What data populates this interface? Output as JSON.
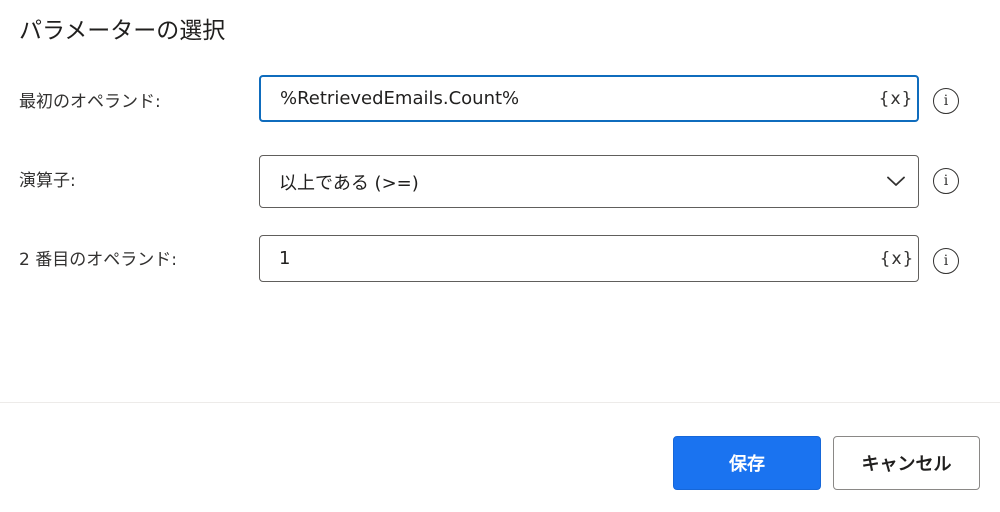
{
  "dialog": {
    "title": "パラメーターの選択"
  },
  "fields": {
    "first_operand": {
      "label": "最初のオペランド:",
      "value": "%RetrievedEmails.Count%",
      "var_icon": "{x}",
      "info_icon": "i"
    },
    "operator": {
      "label": "演算子:",
      "value": "以上である (>=)",
      "info_icon": "i"
    },
    "second_operand": {
      "label": "2 番目のオペランド:",
      "value": "1",
      "var_icon": "{x}",
      "info_icon": "i"
    }
  },
  "buttons": {
    "save_label": "保存",
    "cancel_label": "キャンセル"
  },
  "colors": {
    "accent": "#1a73f0",
    "focus_border": "#0f6cbd",
    "border": "#605e5c",
    "text": "#201f1e"
  },
  "icons": {
    "variable": "variable-icon",
    "dropdown": "chevron-down-icon",
    "info": "info-icon"
  }
}
